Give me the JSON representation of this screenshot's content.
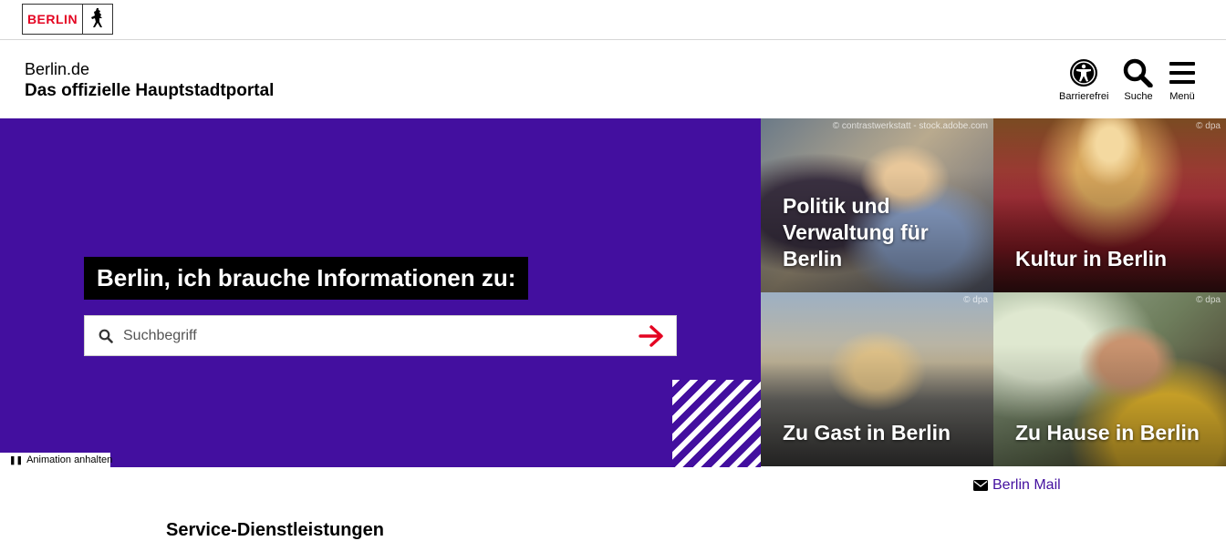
{
  "logo": {
    "text": "BERLIN",
    "emblem": "bear-icon"
  },
  "header": {
    "site_name": "Berlin.de",
    "site_subtitle": "Das offizielle Hauptstadtportal",
    "buttons": [
      {
        "label": "Barrierefrei",
        "icon": "accessibility-icon"
      },
      {
        "label": "Suche",
        "icon": "search-icon"
      },
      {
        "label": "Menü",
        "icon": "hamburger-menu-icon"
      }
    ]
  },
  "hero": {
    "question": "Berlin, ich brauche Informationen zu:",
    "search_placeholder": "Suchbegriff",
    "search_value": "",
    "animation_toggle": "Animation anhalten",
    "background_color": "#430f9f"
  },
  "tiles": [
    {
      "title": "Politik und Verwaltung für Berlin",
      "credit": "© contrastwerkstatt - stock.adobe.com"
    },
    {
      "title": "Kultur in Berlin",
      "credit": "© dpa"
    },
    {
      "title": "Zu Gast in Berlin",
      "credit": "© dpa"
    },
    {
      "title": "Zu Hause in Berlin",
      "credit": "© dpa"
    }
  ],
  "links": {
    "mail": "Berlin Mail"
  },
  "sections": {
    "service_heading": "Service-Dienstleistungen"
  },
  "colors": {
    "brand_red": "#e40422",
    "accent_purple": "#430f9f"
  }
}
